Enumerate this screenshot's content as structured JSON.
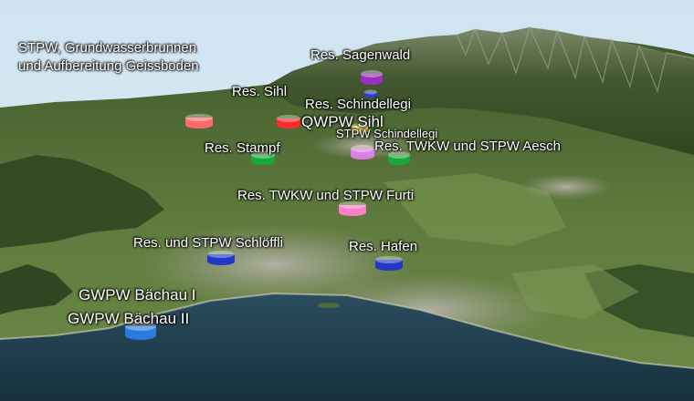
{
  "map": {
    "colors": {
      "sky": "#d6e7f3",
      "lake": "#1f3d4c",
      "terrain_light": "#6f8a4a",
      "terrain_dark": "#2c4420",
      "town": "#a7a59a"
    },
    "labels": [
      {
        "text": "STPW, Grundwasserbrunnen",
        "marker_color": "#ff6a6a"
      },
      {
        "text": "und Aufbereitung Geissboden"
      },
      {
        "text": "Res. Sagenwald",
        "marker_color": "#9a2fc0"
      },
      {
        "text": "Res. Sihl",
        "marker_color": "#2a3fcf"
      },
      {
        "text": "Res. Schindellegi"
      },
      {
        "text": "QWPW Sihl",
        "marker_color": "#ff2a2a"
      },
      {
        "text": "STPW Schindellegi",
        "marker_color": "#ffd24a"
      },
      {
        "text": "Res. Stampf",
        "marker_color": "#16a83a"
      },
      {
        "text": "Res. TWKW und STPW Aesch",
        "marker_color": "#16a83a"
      },
      {
        "text": "Res. TWKW und STPW Furti",
        "marker_color": "#ff7fc7"
      },
      {
        "text": "Res. und STPW Schlöffli",
        "marker_color": "#2038c8"
      },
      {
        "text": "Res. Hafen",
        "marker_color": "#2038c8"
      },
      {
        "text": "GWPW Bächau I"
      },
      {
        "text": "GWPW Bächau II",
        "marker_color": "#2a7be0"
      }
    ],
    "extra_markers": [
      {
        "color": "#d97fe6"
      }
    ]
  }
}
